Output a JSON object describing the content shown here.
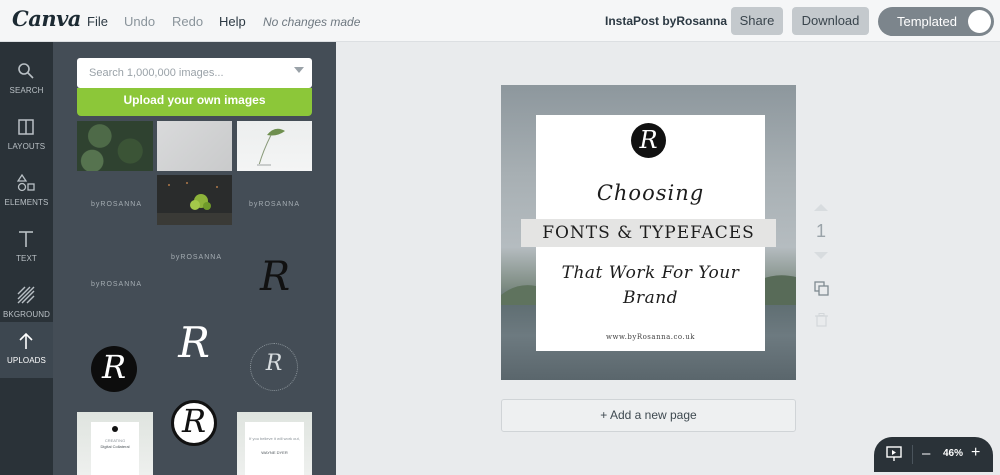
{
  "app": {
    "logo": "Canva",
    "menu": {
      "file": "File",
      "undo": "Undo",
      "redo": "Redo",
      "help": "Help"
    },
    "status": "No changes made",
    "doc_title": "InstaPost byRosanna",
    "share": "Share",
    "download": "Download",
    "mode_toggle": "Templated"
  },
  "sidebar": {
    "items": [
      {
        "label": "SEARCH",
        "icon": "search-icon"
      },
      {
        "label": "LAYOUTS",
        "icon": "layouts-icon"
      },
      {
        "label": "ELEMENTS",
        "icon": "elements-icon"
      },
      {
        "label": "TEXT",
        "icon": "text-icon"
      },
      {
        "label": "BKGROUND",
        "icon": "background-icon"
      },
      {
        "label": "UPLOADS",
        "icon": "upload-icon",
        "active": true
      }
    ]
  },
  "uploads": {
    "search_placeholder": "Search 1,000,000 images...",
    "upload_button": "Upload your own images",
    "brand_mark": "byROSANNA",
    "logo_letter": "R",
    "card_small": {
      "line1": "CREATING",
      "line2": "Digital Collateral"
    },
    "card_quote": {
      "line1": "If you believe it will work out,",
      "author": "WAYNE DYER"
    }
  },
  "canvas": {
    "logo_letter": "R",
    "heading": "Choosing",
    "banner": "FONTS & TYPEFACES",
    "subheading_line1": "That Work For Your",
    "subheading_line2": "Brand",
    "website": "www.byRosanna.co.uk",
    "add_page": "+ Add a new page",
    "page_number": "1"
  },
  "zoom": {
    "level": "46%",
    "minus": "–",
    "plus": "+"
  },
  "colors": {
    "accent_green": "#8cc739",
    "rail_bg": "#2a3238",
    "panel_bg": "#444d56"
  }
}
